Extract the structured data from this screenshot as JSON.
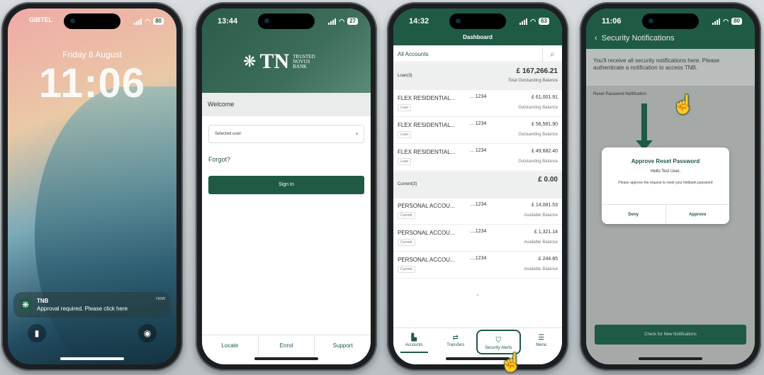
{
  "phone1": {
    "carrier": "GIBTEL",
    "battery": "80",
    "date": "Friday 8 August",
    "time": "11:06",
    "notification": {
      "app": "TNB",
      "message": "Approval required. Please click here",
      "when": "now"
    }
  },
  "phone2": {
    "time": "13:44",
    "battery": "27",
    "logo": {
      "mark": "TN",
      "tag1": "TRUSTED",
      "tag2": "NOVUS",
      "tag3": "BANK"
    },
    "welcome": "Welcome",
    "selected_user": "Selected user:",
    "forgot": "Forgot?",
    "sign_in": "Sign In",
    "footer": [
      "Locate",
      "Enrol",
      "Support"
    ]
  },
  "phone3": {
    "time": "14:32",
    "battery": "63",
    "title": "Dashboard",
    "tab": "All Accounts",
    "groups": [
      {
        "name": "Loan(3)",
        "total": "£ 167,266.21",
        "sub": "Total Outstanding Balance"
      },
      {
        "name": "Current(3)",
        "total": "£ 0.00",
        "sub": ""
      }
    ],
    "accounts": [
      {
        "name": "FLEX RESIDENTIAL...",
        "no": "... 1234",
        "badge": "Loan",
        "amount": "£ 61,001.91",
        "label": "Outstanding Balance"
      },
      {
        "name": "FLEX RESIDENTIAL...",
        "no": "... 1234",
        "badge": "Loan",
        "amount": "£ 56,581.90",
        "label": "Outstanding Balance"
      },
      {
        "name": "FLEX RESIDENTIAL...",
        "no": "... 1234",
        "badge": "Loan",
        "amount": "£ 49,682.40",
        "label": "Outstanding Balance"
      },
      {
        "name": "PERSONAL ACCOU...",
        "no": "....1234",
        "badge": "Current",
        "amount": "£ 14,081.53",
        "label": "Available Balance"
      },
      {
        "name": "PERSONAL ACCOU...",
        "no": "....1234",
        "badge": "Current",
        "amount": "£ 1,321.14",
        "label": "Available Balance"
      },
      {
        "name": "PERSONAL ACCOU...",
        "no": "....1234",
        "badge": "Current",
        "amount": "£ 244.85",
        "label": "Available Balance"
      }
    ],
    "nav": [
      "Accounts",
      "Transfers",
      "Security Alerts",
      "Menu"
    ]
  },
  "phone4": {
    "time": "11:06",
    "battery": "80",
    "title": "Security Notifications",
    "info": "You'll receive all security notifications here. Please authenticate a notification to access TNB.",
    "item": "Reset Password Notification",
    "dialog": {
      "title": "Approve Reset Password",
      "hello": "Hello Test User,",
      "message": "Please approve the request to reset your Netbank password",
      "deny": "Deny",
      "approve": "Approve"
    },
    "check": "Check for New Notifications"
  },
  "colors": {
    "brand": "#1f5a45"
  }
}
